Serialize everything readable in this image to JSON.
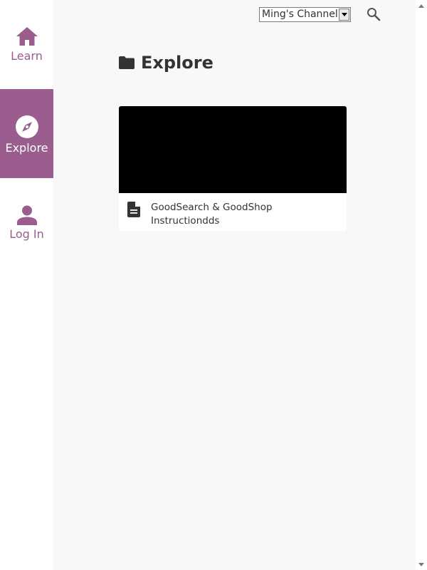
{
  "sidebar": {
    "items": [
      {
        "label": "Learn",
        "icon": "home-icon",
        "active": false
      },
      {
        "label": "Explore",
        "icon": "compass-icon",
        "active": true
      },
      {
        "label": "Log In",
        "icon": "person-icon",
        "active": false
      }
    ]
  },
  "header": {
    "channel_select": {
      "value": "Ming's Channel"
    },
    "search_icon": "search-icon"
  },
  "main": {
    "title": "Explore",
    "title_icon": "folder-icon",
    "cards": [
      {
        "title": "GoodSearch & GoodShop Instructiondds",
        "type_icon": "document-icon"
      }
    ]
  },
  "colors": {
    "accent": "#9a5d8e",
    "main_background": "#f8f8f8",
    "text": "#333333"
  }
}
